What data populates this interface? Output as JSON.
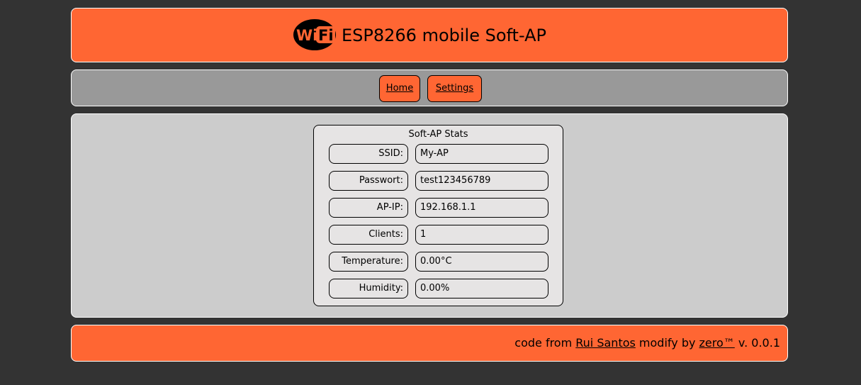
{
  "header": {
    "logo_text": "WiFi",
    "title": "ESP8266 mobile Soft-AP"
  },
  "nav": {
    "home_label": "Home",
    "settings_label": "Settings"
  },
  "stats": {
    "title": "Soft-AP Stats",
    "rows": [
      {
        "label": "SSID:",
        "value": "My-AP"
      },
      {
        "label": "Passwort:",
        "value": "test123456789"
      },
      {
        "label": "AP-IP:",
        "value": "192.168.1.1"
      },
      {
        "label": "Clients:",
        "value": "1"
      },
      {
        "label": "Temperature:",
        "value": "0.00°C"
      },
      {
        "label": "Humidity:",
        "value": "0.00%"
      }
    ]
  },
  "footer": {
    "prefix": "code from ",
    "author_link": "Rui Santos",
    "middle": " modify by ",
    "modifier_link": "zero™",
    "version": " v. 0.0.1"
  },
  "colors": {
    "background": "#333333",
    "accent": "#ff6633",
    "nav_bg": "#999999",
    "content_bg": "#cccccc",
    "box_bg": "#e6e4e4"
  }
}
